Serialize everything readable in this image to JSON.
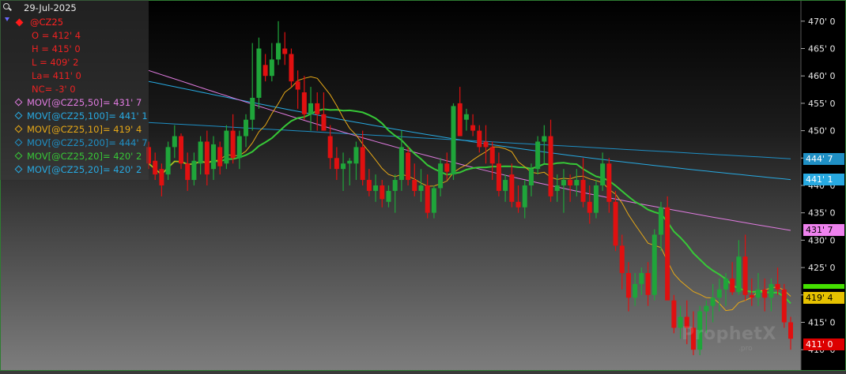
{
  "date": "29-Jul-2025",
  "symbol": "@CZ25",
  "ohlc": {
    "open": "O = 412' 4",
    "high": "H = 415' 0",
    "low": "L = 409' 2",
    "last": "La= 411' 0",
    "net_change": "NC= -3' 0"
  },
  "indicators": [
    {
      "label": "MOV[@CZ25,50]= 431' 7",
      "color": "#e07be0"
    },
    {
      "label": "MOV[@CZ25,100]= 441' 1",
      "color": "#27a9e1"
    },
    {
      "label": "MOV[@CZ25,10]= 419' 4",
      "color": "#e6a817"
    },
    {
      "label": "MOV[@CZ25,200]= 444' 7",
      "color": "#1f8fc4"
    },
    {
      "label": "MOV[@CZ25,20]= 420' 2",
      "color": "#37c837"
    },
    {
      "label": "MOV[@CZ25,20]= 420' 2",
      "color": "#27a9e1"
    }
  ],
  "price_tags": [
    {
      "label": "444' 7",
      "value": 444.875,
      "bg": "#1f8fc4",
      "fg": "#ffffff"
    },
    {
      "label": "441' 1",
      "value": 441.125,
      "bg": "#27a9e1",
      "fg": "#ffffff"
    },
    {
      "label": "431' 7",
      "value": 431.875,
      "bg": "#ee82ee",
      "fg": "#000000"
    },
    {
      "label": "419' 4",
      "value": 419.5,
      "bg": "#e6c200",
      "fg": "#000000"
    },
    {
      "label": "411' 0",
      "value": 411.0,
      "bg": "#dd0000",
      "fg": "#ffffff"
    }
  ],
  "green_tag_value": 421.5,
  "watermark": "ProphetX",
  "watermark_sub": ".pro",
  "chart_data": {
    "type": "candlestick",
    "ylim": [
      407,
      473
    ],
    "y_ticks": [
      "410' 0",
      "415' 0",
      "420' 0",
      "425' 0",
      "430' 0",
      "435' 0",
      "440' 0",
      "445' 0",
      "450' 0",
      "455' 0",
      "460' 0",
      "465' 0",
      "470' 0"
    ],
    "y_tick_values": [
      410,
      415,
      420,
      425,
      430,
      435,
      440,
      445,
      450,
      455,
      460,
      465,
      470
    ],
    "candles": [
      [
        447,
        448,
        443,
        444
      ],
      [
        444.5,
        446,
        441,
        442
      ],
      [
        443,
        444,
        438,
        440
      ],
      [
        442,
        448,
        441,
        447
      ],
      [
        447,
        451,
        445,
        449
      ],
      [
        449,
        449.5,
        443,
        444
      ],
      [
        444,
        446,
        439,
        441
      ],
      [
        441,
        446,
        440,
        444.5
      ],
      [
        444,
        449,
        442,
        448
      ],
      [
        448,
        450,
        440,
        442
      ],
      [
        443,
        449,
        441,
        447.5
      ],
      [
        447,
        448,
        442,
        443.5
      ],
      [
        444,
        451,
        443,
        450
      ],
      [
        450,
        453,
        444,
        445
      ],
      [
        445,
        450,
        443,
        449
      ],
      [
        449,
        453,
        447,
        452
      ],
      [
        452,
        466,
        450,
        456
      ],
      [
        456,
        467,
        454,
        465
      ],
      [
        462,
        464,
        459,
        460
      ],
      [
        460,
        466,
        459,
        463
      ],
      [
        463,
        470,
        462,
        466
      ],
      [
        465,
        468,
        462,
        464
      ],
      [
        464,
        465,
        458,
        459
      ],
      [
        459,
        461,
        454,
        457.5
      ],
      [
        457,
        460,
        452,
        453
      ],
      [
        453,
        458,
        450,
        455
      ],
      [
        455,
        457,
        450,
        453
      ],
      [
        453,
        457,
        450,
        450
      ],
      [
        449,
        451,
        443,
        445
      ],
      [
        445,
        447,
        441,
        443
      ],
      [
        443,
        446,
        439,
        444
      ],
      [
        444,
        445,
        440,
        444.5
      ],
      [
        444,
        448,
        441,
        447
      ],
      [
        447,
        450,
        440,
        441
      ],
      [
        441,
        443,
        438,
        439
      ],
      [
        439,
        442,
        437,
        440
      ],
      [
        440,
        441,
        436,
        437.5
      ],
      [
        437,
        440,
        436,
        439
      ],
      [
        439,
        442,
        435,
        441
      ],
      [
        441,
        450,
        439,
        447
      ],
      [
        446,
        447,
        440,
        441
      ],
      [
        441,
        444,
        438,
        439
      ],
      [
        439,
        443,
        437,
        440
      ],
      [
        440,
        442,
        434,
        435
      ],
      [
        435,
        440,
        434,
        439.5
      ],
      [
        439.5,
        445,
        438,
        444
      ],
      [
        444,
        446,
        441,
        442.5
      ],
      [
        442,
        455,
        441,
        454.5
      ],
      [
        455,
        458,
        449,
        449
      ],
      [
        452,
        454,
        450,
        453
      ],
      [
        451,
        453,
        449,
        450
      ],
      [
        450,
        451,
        446,
        447
      ],
      [
        448,
        451,
        444,
        447
      ],
      [
        447,
        448,
        441,
        444
      ],
      [
        444,
        446,
        438,
        439
      ],
      [
        439,
        442,
        437,
        441
      ],
      [
        442,
        444,
        436,
        437
      ],
      [
        437,
        440,
        435,
        436
      ],
      [
        436,
        441,
        434,
        440
      ],
      [
        440,
        444,
        438,
        443
      ],
      [
        443,
        449,
        442,
        448
      ],
      [
        448,
        451,
        444,
        449
      ],
      [
        449,
        452,
        437,
        438
      ],
      [
        439,
        442,
        437,
        440
      ],
      [
        440,
        443,
        435,
        441
      ],
      [
        441,
        442,
        437,
        440
      ],
      [
        440,
        443,
        438,
        441
      ],
      [
        441,
        445,
        436,
        437
      ],
      [
        437,
        440,
        433,
        435
      ],
      [
        435,
        441,
        434,
        440
      ],
      [
        440,
        446,
        439,
        444
      ],
      [
        444,
        445,
        435,
        437
      ],
      [
        437,
        439,
        428,
        429
      ],
      [
        429,
        431,
        421,
        424
      ],
      [
        424,
        426,
        417,
        419.5
      ],
      [
        419.5,
        424,
        418,
        422
      ],
      [
        422,
        425,
        420,
        424
      ],
      [
        424,
        426,
        418,
        420
      ],
      [
        420,
        432,
        419,
        431
      ],
      [
        431,
        437,
        428,
        436
      ],
      [
        436,
        438,
        421,
        419
      ],
      [
        419,
        420,
        413,
        414
      ],
      [
        414,
        418,
        412,
        416
      ],
      [
        416,
        419,
        411,
        414
      ],
      [
        414,
        417,
        409,
        410
      ],
      [
        410,
        418,
        409,
        417
      ],
      [
        417,
        419,
        413,
        418
      ],
      [
        418,
        422,
        415,
        419.5
      ],
      [
        419.5,
        423,
        417,
        421
      ],
      [
        421,
        424,
        418,
        423
      ],
      [
        423,
        426,
        420,
        420.5
      ],
      [
        420.5,
        430,
        420,
        427
      ],
      [
        427,
        431,
        419,
        420
      ],
      [
        420,
        423,
        418,
        419.5
      ],
      [
        419.5,
        424,
        418,
        421
      ],
      [
        421,
        423,
        417,
        419.5
      ],
      [
        419.5,
        423,
        417,
        422
      ],
      [
        422,
        425,
        420,
        421
      ],
      [
        421,
        422,
        414,
        415
      ],
      [
        415,
        416,
        410,
        412
      ]
    ]
  }
}
